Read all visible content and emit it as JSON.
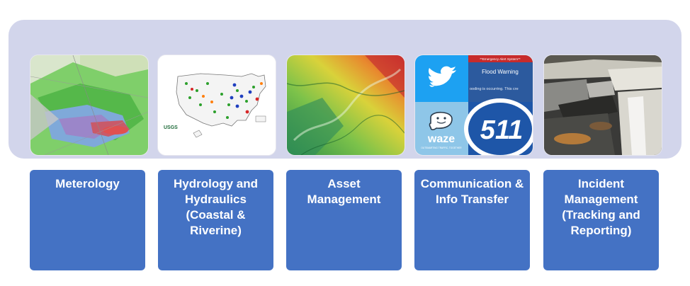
{
  "colors": {
    "band": "#d2d5eb",
    "box": "#4472c4",
    "box_text": "#ffffff"
  },
  "panels": [
    {
      "image": "weather-radar-map-image",
      "label_lines": [
        "Meterology"
      ]
    },
    {
      "image": "us-streamflow-map-image",
      "map_logo": "USGS",
      "label_lines": [
        "Hydrology and",
        "Hydraulics",
        "(Coastal &",
        "Riverine)"
      ]
    },
    {
      "image": "terrain-elevation-map-image",
      "label_lines": [
        "Asset",
        "Management"
      ]
    },
    {
      "image": "communication-apps-collage-image",
      "alert_header": "**Emergency Alert System**",
      "alert_title": "Flood Warning",
      "alert_body": "ooding is occurring. This cre",
      "waze_text": "waze",
      "waze_subtext": "OUTSMARTING TRAFFIC, TOGETHER",
      "num_511": "511",
      "label_lines": [
        "Communication &",
        "Info Transfer"
      ]
    },
    {
      "image": "waterfall-photo-image",
      "label_lines": [
        "Incident",
        "Management",
        "(Tracking and",
        "Reporting)"
      ]
    }
  ]
}
